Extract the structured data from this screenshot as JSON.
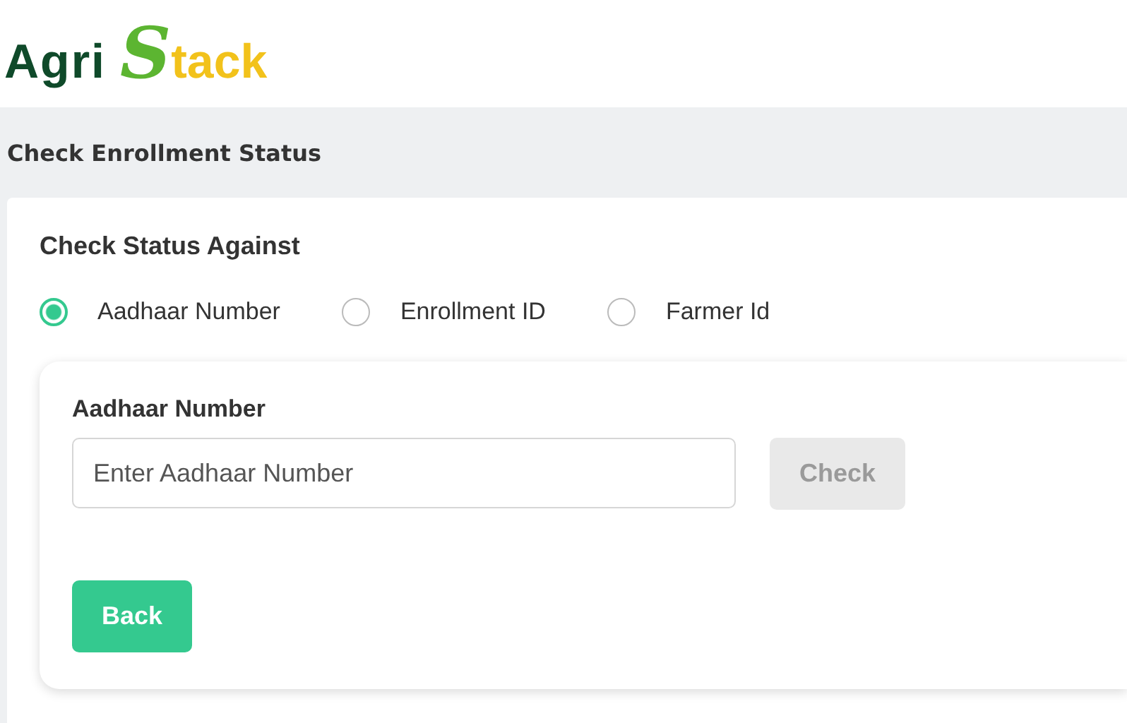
{
  "logo": {
    "part_1": "Agri",
    "part_2": "S",
    "part_3": "tack"
  },
  "header": {
    "title": "Check Enrollment Status"
  },
  "form": {
    "label": "Check Status Against",
    "options": [
      {
        "label": "Aadhaar Number",
        "selected": true
      },
      {
        "label": "Enrollment ID",
        "selected": false
      },
      {
        "label": "Farmer Id",
        "selected": false
      }
    ],
    "field": {
      "label": "Aadhaar Number",
      "placeholder": "Enter Aadhaar Number"
    },
    "buttons": [
      {
        "label": "Check",
        "disabled": true
      },
      {
        "label": "Back",
        "disabled": false
      }
    ]
  }
}
